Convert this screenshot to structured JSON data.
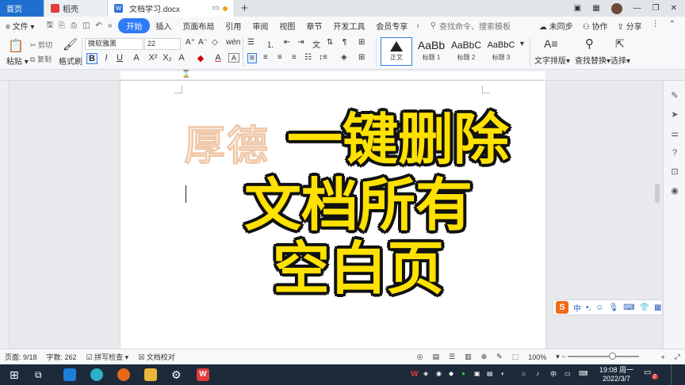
{
  "tabs": {
    "home": "首页",
    "daoke": "稻壳",
    "doc": "文档学习.docx"
  },
  "menu": {
    "file": "文件",
    "items": [
      "开始",
      "插入",
      "页面布局",
      "引用",
      "审阅",
      "视图",
      "章节",
      "开发工具",
      "会员专享"
    ],
    "search": "查找命令、搜索模板",
    "unsynced": "未同步",
    "collab": "协作",
    "share": "分享"
  },
  "ribbon": {
    "paste": "粘贴",
    "cut": "剪切",
    "copy": "复制",
    "format_painter": "格式刷",
    "font_name": "微软雅黑",
    "font_size": "22",
    "styles": [
      "AaBb",
      "AaBbC",
      "AaBbC"
    ],
    "style_labels": [
      "正文",
      "标题 1",
      "标题 2",
      "标题 3"
    ],
    "text_layout": "文字排版",
    "find_replace": "查找替换",
    "select": "选择"
  },
  "document": {
    "watermark": "厚德",
    "overlay_lines": [
      "一键删除",
      "文档所有",
      "空白页"
    ]
  },
  "ime": {
    "lang": "中"
  },
  "status": {
    "page": "页面: 9/18",
    "words": "字数: 262",
    "spell": "拼写检查",
    "proof": "文档校对",
    "zoom": "100%"
  },
  "taskbar": {
    "time": "19:08 周一",
    "date": "2022/3/7",
    "notif": "2"
  },
  "colors": {
    "accent": "#2f7bf5",
    "overlay_text": "#ffe100",
    "taskbar": "#1c2a3a"
  }
}
